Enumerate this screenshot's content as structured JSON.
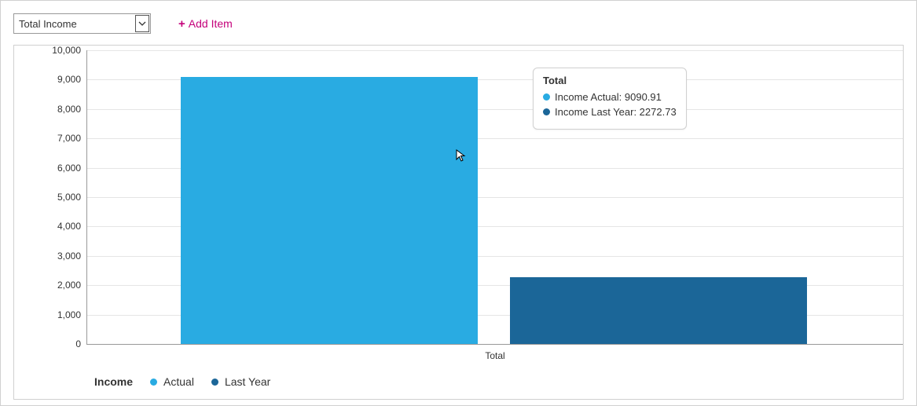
{
  "toolbar": {
    "select_value": "Total Income",
    "add_item_label": "Add Item"
  },
  "tooltip": {
    "title": "Total",
    "row1": "Income Actual: 9090.91",
    "row2": "Income Last Year: 2272.73"
  },
  "legend": {
    "title": "Income",
    "item1": "Actual",
    "item2": "Last Year"
  },
  "xcat": "Total",
  "yticks": [
    "0",
    "1,000",
    "2,000",
    "3,000",
    "4,000",
    "5,000",
    "6,000",
    "7,000",
    "8,000",
    "9,000",
    "10,000"
  ],
  "colors": {
    "actual": "#29abe2",
    "lastyear": "#1b6698",
    "accent": "#c4007a"
  },
  "chart_data": {
    "type": "bar",
    "categories": [
      "Total"
    ],
    "series": [
      {
        "name": "Income Actual",
        "values": [
          9090.91
        ],
        "color": "#29abe2"
      },
      {
        "name": "Income Last Year",
        "values": [
          2272.73
        ],
        "color": "#1b6698"
      }
    ],
    "title": "",
    "xlabel": "",
    "ylabel": "",
    "ylim": [
      0,
      10000
    ],
    "ytick_step": 1000,
    "legend_title": "Income",
    "legend_labels": [
      "Actual",
      "Last Year"
    ],
    "tooltip": {
      "category": "Total",
      "rows": [
        {
          "label": "Income Actual",
          "value": 9090.91
        },
        {
          "label": "Income Last Year",
          "value": 2272.73
        }
      ]
    }
  }
}
